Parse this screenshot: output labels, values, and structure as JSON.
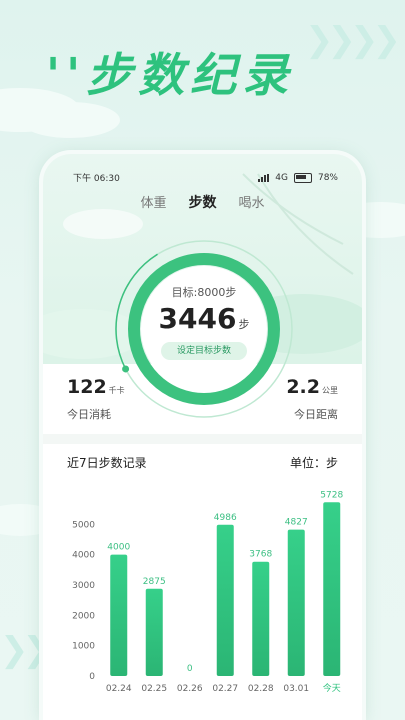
{
  "promo": {
    "title": "''步数纪录"
  },
  "status": {
    "time": "下午 06:30",
    "network": "4G",
    "battery": "78%"
  },
  "tabs": [
    {
      "label": "体重",
      "active": false
    },
    {
      "label": "步数",
      "active": true
    },
    {
      "label": "喝水",
      "active": false
    }
  ],
  "progress": {
    "target_text": "目标:8000步",
    "steps": "3446",
    "unit": "步",
    "set_button": "设定目标步数",
    "fraction": 0.43
  },
  "stats": {
    "calories": {
      "value": "122",
      "unit": "千卡",
      "label": "今日消耗"
    },
    "distance": {
      "value": "2.2",
      "unit": "公里",
      "label": "今日距离"
    }
  },
  "records": {
    "title": "近7日步数记录",
    "unit_label": "单位：步"
  },
  "colors": {
    "accent": "#2ec27e",
    "bar_top": "#36d08a",
    "bar_bottom": "#2bb574"
  },
  "chart_data": {
    "type": "bar",
    "categories": [
      "02.24",
      "02.25",
      "02.26",
      "02.27",
      "02.28",
      "03.01",
      "今天"
    ],
    "values": [
      4000,
      2875,
      0,
      4986,
      3768,
      4827,
      5728
    ],
    "value_labels": [
      "4000",
      "2875",
      "0",
      "4986",
      "3768",
      "4827",
      "5728"
    ],
    "yticks": [
      "0",
      "1000",
      "2000",
      "3000",
      "4000",
      "5000"
    ],
    "ylim": [
      0,
      6000
    ],
    "grid": false
  }
}
